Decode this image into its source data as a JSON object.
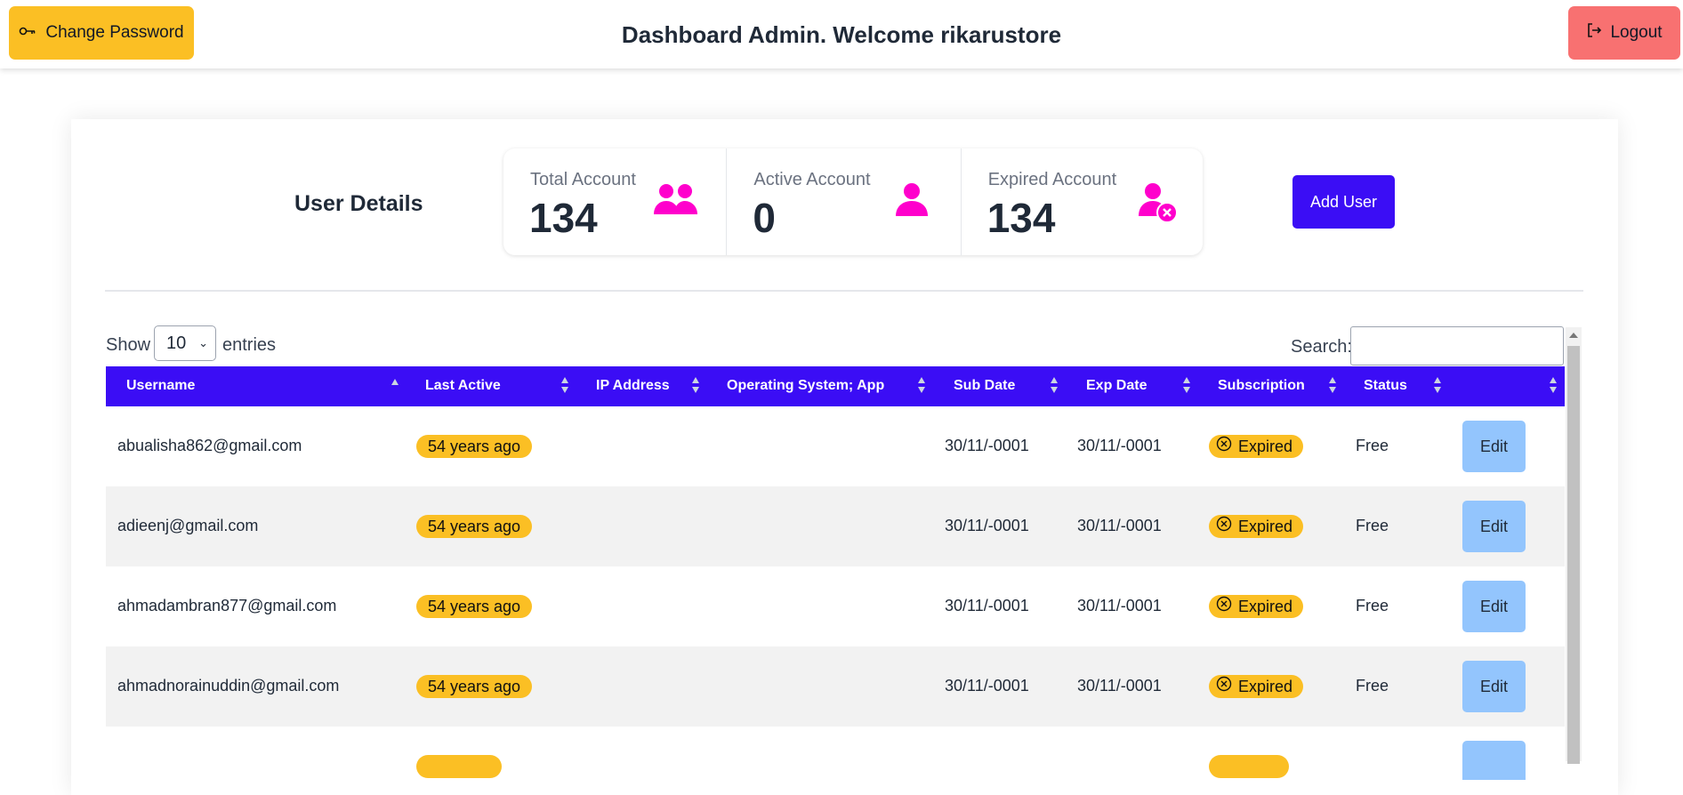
{
  "header": {
    "change_password_label": "Change Password",
    "title": "Dashboard Admin. Welcome rikarustore",
    "logout_label": "Logout"
  },
  "summary": {
    "heading": "User Details",
    "stats": [
      {
        "label": "Total Account",
        "value": "134",
        "icon": "users-icon"
      },
      {
        "label": "Active Account",
        "value": "0",
        "icon": "user-icon"
      },
      {
        "label": "Expired Account",
        "value": "134",
        "icon": "user-expired-icon"
      }
    ],
    "add_user_label": "Add User",
    "icon_color": "#ff00cc"
  },
  "table_controls": {
    "show_label": "Show",
    "page_size": "10",
    "entries_label": "entries",
    "search_label": "Search:",
    "search_value": ""
  },
  "table": {
    "columns": [
      "Username",
      "Last Active",
      "IP Address",
      "Operating System; App",
      "Sub Date",
      "Exp Date",
      "Subscription",
      "Status",
      ""
    ],
    "sorted_column": "Username",
    "rows": [
      {
        "username": "abualisha862@gmail.com",
        "last_active": "54 years ago",
        "ip": "",
        "os": "",
        "sub_date": "30/11/-0001",
        "exp_date": "30/11/-0001",
        "subscription": "Expired",
        "status": "Free",
        "action": "Edit"
      },
      {
        "username": "adieenj@gmail.com",
        "last_active": "54 years ago",
        "ip": "",
        "os": "",
        "sub_date": "30/11/-0001",
        "exp_date": "30/11/-0001",
        "subscription": "Expired",
        "status": "Free",
        "action": "Edit"
      },
      {
        "username": "ahmadambran877@gmail.com",
        "last_active": "54 years ago",
        "ip": "",
        "os": "",
        "sub_date": "30/11/-0001",
        "exp_date": "30/11/-0001",
        "subscription": "Expired",
        "status": "Free",
        "action": "Edit"
      },
      {
        "username": "ahmadnorainuddin@gmail.com",
        "last_active": "54 years ago",
        "ip": "",
        "os": "",
        "sub_date": "30/11/-0001",
        "exp_date": "30/11/-0001",
        "subscription": "Expired",
        "status": "Free",
        "action": "Edit"
      },
      {
        "username": "",
        "last_active": "",
        "ip": "",
        "os": "",
        "sub_date": "",
        "exp_date": "",
        "subscription": "",
        "status": "",
        "action": ""
      }
    ]
  },
  "colors": {
    "primary": "#3b0df5",
    "warning": "#fbbf24",
    "danger": "#f87171",
    "edit": "#93c5fd",
    "accent_icon": "#ff00cc"
  }
}
